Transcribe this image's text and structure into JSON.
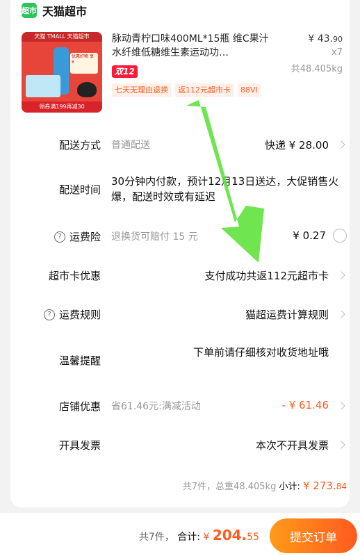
{
  "shop": {
    "logo_text": "超市",
    "name": "天猫超市"
  },
  "product": {
    "thumb_banner": "天猫 TMALL 天猫超市",
    "thumb_card": "优惠好物 享 ¥",
    "thumb_foot": "领券满199再减30",
    "title": "脉动青柠口味400ML*15瓶 维C果汁水纤维低糖维生素运动功…",
    "price_int": "¥ 43.",
    "price_dec": "90",
    "qty": "x7",
    "weight": "共48.405kg",
    "promo_tag": "双12",
    "service_tags": [
      "七天无理由退换",
      "返112元超市卡",
      "88VI"
    ]
  },
  "rows": {
    "delivery": {
      "label": "配送方式",
      "sub": "普通配送",
      "value": "快递 ¥ 28.00"
    },
    "delivery_time": {
      "label": "配送时间",
      "text": "30分钟内付款，预计12月13日送达，大促销售火爆，配送时效或有延迟"
    },
    "shipping_insurance": {
      "label": "运费险",
      "help": "?",
      "sub": "退换货可赔付 15 元",
      "value": "¥ 0.27"
    },
    "market_card": {
      "label": "超市卡优惠",
      "value": "支付成功共返112元超市卡"
    },
    "shipping_rule": {
      "label": "运费规则",
      "help": "?",
      "value": "猫超运费计算规则"
    },
    "reminder": {
      "label": "温馨提醒",
      "value": "下单前请仔细核对收货地址哦"
    },
    "shop_discount": {
      "label": "店铺优惠",
      "sub": "省61.46元:满减活动",
      "value": "- ¥ 61.46"
    },
    "invoice": {
      "label": "开具发票",
      "value": "本次不开具发票"
    }
  },
  "summary": {
    "text": "共7件，总重48.405kg",
    "label": "小计:",
    "amount": "¥ 273.",
    "amount_dec": "84"
  },
  "footer": {
    "count": "共7件，",
    "label": "合计:",
    "currency": "¥ ",
    "amount_int": "204.",
    "amount_dec": "55",
    "submit": "提交订单"
  },
  "colors": {
    "accent": "#ff5a1f",
    "brand_green": "#2ec25b",
    "arrow_green": "#5fe23c"
  }
}
